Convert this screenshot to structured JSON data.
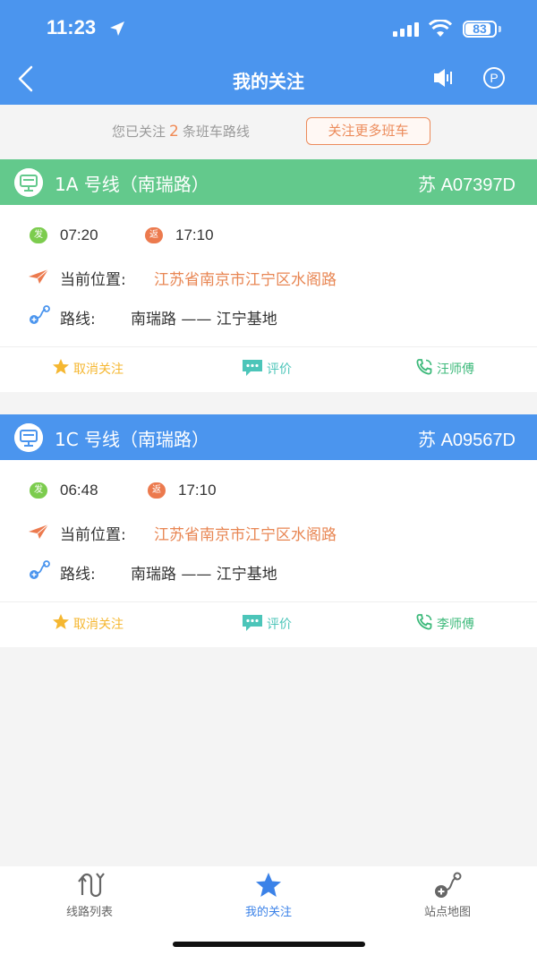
{
  "status_bar": {
    "time": "11:23",
    "battery": "83",
    "battery_level": 0.83
  },
  "header": {
    "title": "我的关注",
    "back_icon": "chevron-left-icon",
    "speaker_icon": "speaker-icon",
    "parking_label": "P"
  },
  "summary": {
    "prefix": "您已关注",
    "count": "2",
    "suffix": "条班车路线",
    "more_button": "关注更多班车"
  },
  "cards": [
    {
      "line": "1A 号线（南瑞路）",
      "plate": "苏 A07397D",
      "head_color": "#63c98c",
      "depart_badge": "发",
      "depart_time": "07:20",
      "return_badge": "返",
      "return_time": "17:10",
      "location_label": "当前位置:",
      "location_value": "江苏省南京市江宁区水阁路",
      "route_label": "路线:",
      "route_value": "南瑞路 —— 江宁基地",
      "actions": {
        "unfollow": "取消关注",
        "review": "评价",
        "driver": "汪师傅"
      }
    },
    {
      "line": "1C 号线（南瑞路）",
      "plate": "苏 A09567D",
      "head_color": "#4b95ee",
      "depart_badge": "发",
      "depart_time": "06:48",
      "return_badge": "返",
      "return_time": "17:10",
      "location_label": "当前位置:",
      "location_value": "江苏省南京市江宁区水阁路",
      "route_label": "路线:",
      "route_value": "南瑞路 —— 江宁基地",
      "actions": {
        "unfollow": "取消关注",
        "review": "评价",
        "driver": "李师傅"
      }
    }
  ],
  "tabbar": {
    "tabs": [
      {
        "label": "线路列表",
        "icon": "route-list-icon"
      },
      {
        "label": "我的关注",
        "icon": "star-icon",
        "active": true
      },
      {
        "label": "站点地图",
        "icon": "station-map-icon"
      }
    ]
  },
  "colors": {
    "brand": "#4b95ee",
    "accent_orange": "#e88653",
    "star_yellow": "#f5b731",
    "teal": "#4cc5b9",
    "phone_green": "#3cb97a"
  }
}
